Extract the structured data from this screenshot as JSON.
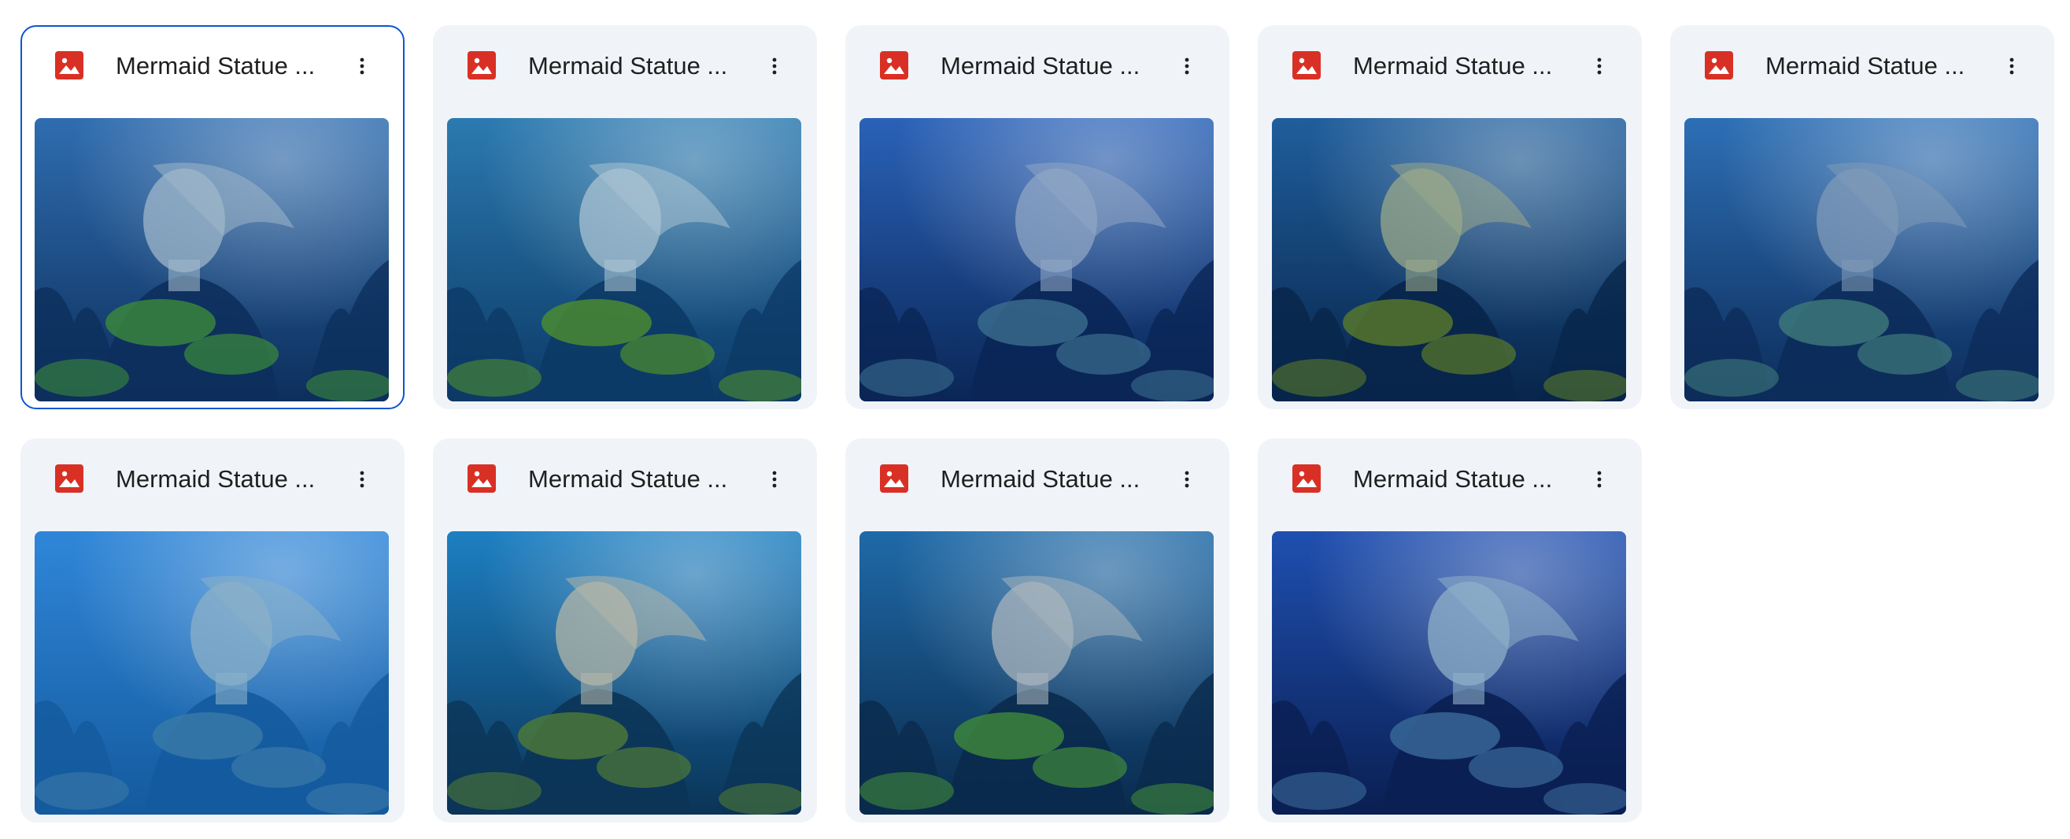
{
  "files": [
    {
      "name": "Mermaid Statue ...",
      "selected": true,
      "icon": "image-file-icon",
      "palette": [
        "#2f6db0",
        "#0d2f5c",
        "#3c8a3a",
        "#9fb7c9"
      ]
    },
    {
      "name": "Mermaid Statue ...",
      "selected": false,
      "icon": "image-file-icon",
      "palette": [
        "#2b7ab0",
        "#0c3a66",
        "#4e8f2e",
        "#a9c3d2"
      ]
    },
    {
      "name": "Mermaid Statue ...",
      "selected": false,
      "icon": "image-file-icon",
      "palette": [
        "#2a62b8",
        "#0a2656",
        "#3b6e8e",
        "#8fa6c4"
      ]
    },
    {
      "name": "Mermaid Statue ...",
      "selected": false,
      "icon": "image-file-icon",
      "palette": [
        "#1f5e9c",
        "#08254a",
        "#5a7a2a",
        "#9aa88a"
      ]
    },
    {
      "name": "Mermaid Statue ...",
      "selected": false,
      "icon": "image-file-icon",
      "palette": [
        "#2d6fb5",
        "#0c2c5a",
        "#3f7a7a",
        "#7f9ab8"
      ]
    },
    {
      "name": "Mermaid Statue ...",
      "selected": false,
      "icon": "image-file-icon",
      "palette": [
        "#2f86d8",
        "#145a9e",
        "#3a7aa8",
        "#8bb0c8"
      ]
    },
    {
      "name": "Mermaid Statue ...",
      "selected": false,
      "icon": "image-file-icon",
      "palette": [
        "#1d7fc2",
        "#0b3457",
        "#4f7a36",
        "#b3b5a8"
      ]
    },
    {
      "name": "Mermaid Statue ...",
      "selected": false,
      "icon": "image-file-icon",
      "palette": [
        "#1f6aa8",
        "#0a2a4c",
        "#3f8a3a",
        "#a8b4bc"
      ]
    },
    {
      "name": "Mermaid Statue ...",
      "selected": false,
      "icon": "image-file-icon",
      "palette": [
        "#1f4fb0",
        "#0a1f52",
        "#3a6a9a",
        "#8fb0c8"
      ]
    }
  ],
  "colors": {
    "card_background": "#f0f4f9",
    "selected_border": "#0b57d0",
    "image_icon_red": "#d93025",
    "text": "#1f1f1f"
  }
}
